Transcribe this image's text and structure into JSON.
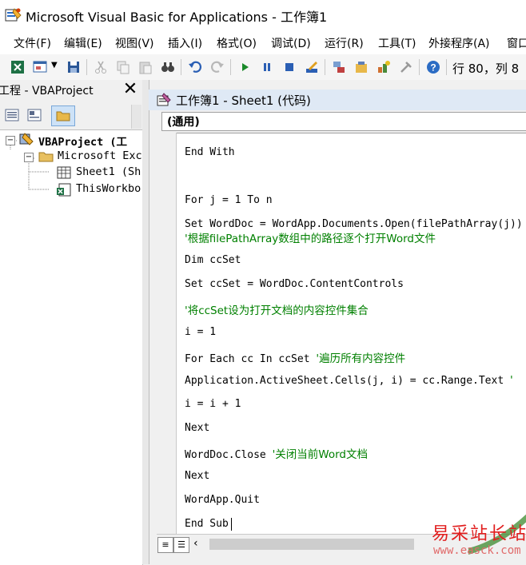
{
  "window": {
    "title": "Microsoft Visual Basic for Applications - 工作簿1"
  },
  "menu": {
    "items": [
      "文件(F)",
      "编辑(E)",
      "视图(V)",
      "插入(I)",
      "格式(O)",
      "调试(D)",
      "运行(R)",
      "工具(T)",
      "外接程序(A)",
      "窗口"
    ]
  },
  "toolbar": {
    "position_readout": "行 80，列 8",
    "icons": [
      "excel-icon",
      "insert-userform-icon",
      "save-icon",
      "cut-icon",
      "copy-icon",
      "paste-icon",
      "find-icon",
      "undo-icon",
      "redo-icon",
      "run-icon",
      "break-icon",
      "reset-icon",
      "design-mode-icon",
      "project-explorer-icon",
      "properties-icon",
      "object-browser-icon",
      "toolbox-icon",
      "help-icon"
    ]
  },
  "project_explorer": {
    "title": "工程 - VBAProject",
    "close": "✕",
    "tree": {
      "root": "VBAProject (工",
      "folder": "Microsoft Exc",
      "sheet": "Sheet1 (Sh",
      "workbook": "ThisWorkbo"
    }
  },
  "code_window": {
    "title": "工作簿1 - Sheet1 (代码)",
    "object_combo": "(通用)",
    "lines": [
      {
        "code": "End With",
        "comment": ""
      },
      {
        "code": "For j = 1 To n",
        "comment": ""
      },
      {
        "code": "Set WordDoc = WordApp.Documents.Open(filePathArray(j))",
        "comment": ""
      },
      {
        "code": "",
        "comment": "'根据filePathArray数组中的路径逐个打开Word文件"
      },
      {
        "code": "Dim ccSet",
        "comment": ""
      },
      {
        "code": "Set ccSet = WordDoc.ContentControls",
        "comment": ""
      },
      {
        "code": "",
        "comment": "'将ccSet设为打开文档的内容控件集合"
      },
      {
        "code": "i = 1",
        "comment": ""
      },
      {
        "code": "For Each cc In ccSet ",
        "comment": "'遍历所有内容控件"
      },
      {
        "code": "Application.ActiveSheet.Cells(j, i) = cc.Range.Text ",
        "comment": "'"
      },
      {
        "code": "i = i + 1",
        "comment": ""
      },
      {
        "code": "Next",
        "comment": ""
      },
      {
        "code": "WordDoc.Close ",
        "comment": "'关闭当前Word文档"
      },
      {
        "code": "Next",
        "comment": ""
      },
      {
        "code": "WordApp.Quit",
        "comment": ""
      },
      {
        "code": "End Sub",
        "comment": ""
      }
    ]
  },
  "watermark": {
    "line1": "易采站长站",
    "line2": "www.easck.com"
  }
}
